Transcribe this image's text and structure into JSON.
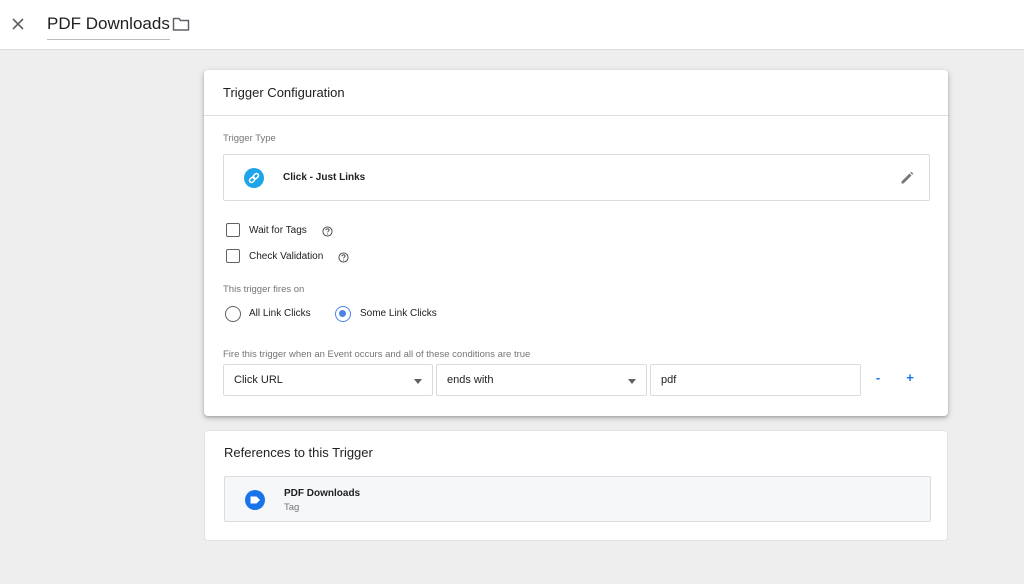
{
  "header": {
    "title": "PDF Downloads",
    "close_icon": "close-icon",
    "folder_icon": "folder-icon"
  },
  "trigger_config": {
    "heading": "Trigger Configuration",
    "type_label": "Trigger Type",
    "type_name": "Click - Just Links",
    "type_icon": "link-icon",
    "type_icon_color": "#1ea4e9",
    "checkboxes": [
      {
        "label": "Wait for Tags",
        "checked": false
      },
      {
        "label": "Check Validation",
        "checked": false
      }
    ],
    "fires_on_label": "This trigger fires on",
    "fires_on_options": [
      {
        "label": "All Link Clicks",
        "selected": false
      },
      {
        "label": "Some Link Clicks",
        "selected": true
      }
    ],
    "condition_label": "Fire this trigger when an Event occurs and all of these conditions are true",
    "condition": {
      "variable": "Click URL",
      "operator": "ends with",
      "value": "pdf"
    },
    "remove_label": "-",
    "add_label": "+"
  },
  "references": {
    "heading": "References to this Trigger",
    "items": [
      {
        "name": "PDF Downloads",
        "kind": "Tag",
        "icon": "tag-icon"
      }
    ]
  },
  "colors": {
    "accent": "#1a73e8",
    "radio_selected": "#4a86e8",
    "background": "#eeeeef"
  }
}
